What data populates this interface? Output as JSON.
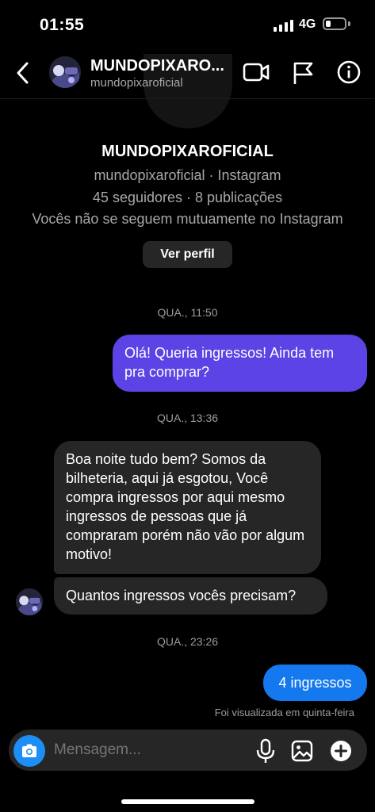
{
  "status_bar": {
    "time": "01:55",
    "network": "4G",
    "battery_level": 0.25
  },
  "header": {
    "display_name": "MUNDOPIXARO...",
    "username": "mundopixaroficial",
    "icons": [
      "back-chevron-icon",
      "video-call-icon",
      "flag-icon",
      "info-icon"
    ]
  },
  "profile_card": {
    "name": "MUNDOPIXAROFICIAL",
    "source": "mundopixaroficial · Instagram",
    "stats": "45 seguidores · 8 publicações",
    "relationship": "Vocês não se seguem mutuamente no Instagram",
    "view_profile_label": "Ver perfil"
  },
  "messages": [
    {
      "type": "timestamp",
      "text": "QUA., 11:50"
    },
    {
      "type": "sent",
      "text": "Olá! Queria ingressos! Ainda tem pra comprar?"
    },
    {
      "type": "timestamp",
      "text": "QUA., 13:36"
    },
    {
      "type": "received",
      "text": "Boa noite tudo bem? Somos da bilheteria, aqui já esgotou, Você compra ingressos por aqui mesmo ingressos de pessoas que já compraram porém não vão por algum motivo!"
    },
    {
      "type": "received",
      "text": "Quantos ingressos vocês precisam?"
    },
    {
      "type": "timestamp",
      "text": "QUA., 23:26"
    },
    {
      "type": "sent",
      "text": "4 ingressos"
    }
  ],
  "seen_status": "Foi visualizada em quinta-feira",
  "composer": {
    "placeholder": "Mensagem...",
    "icons": [
      "camera-icon",
      "microphone-icon",
      "gallery-icon",
      "add-icon"
    ]
  },
  "colors": {
    "sent_purple": "#5b43e6",
    "sent_blue": "#1479ee",
    "received": "#262626",
    "camera_blue": "#1c8ef5"
  }
}
